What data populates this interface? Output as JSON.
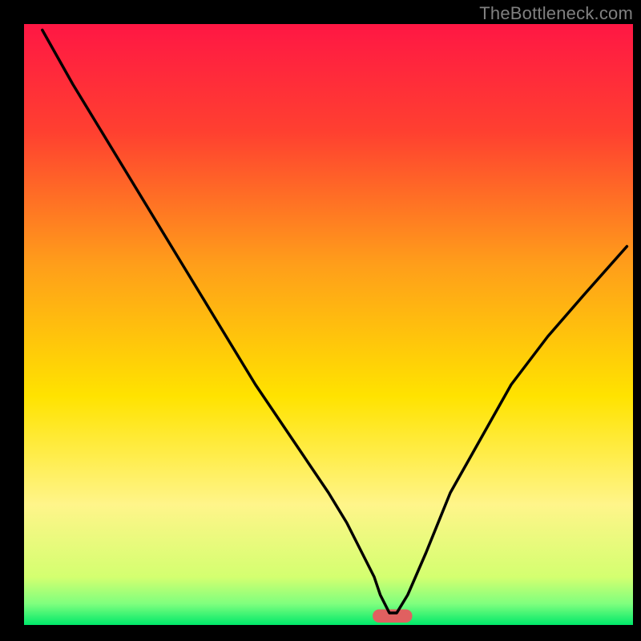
{
  "watermark": "TheBottleneck.com",
  "chart_data": {
    "type": "line",
    "title": "",
    "xlabel": "",
    "ylabel": "",
    "xlim": [
      0,
      100
    ],
    "ylim": [
      0,
      100
    ],
    "grid": false,
    "legend": false,
    "background_gradient_stops": [
      {
        "offset": 0.0,
        "color": "#ff1744"
      },
      {
        "offset": 0.18,
        "color": "#ff4030"
      },
      {
        "offset": 0.4,
        "color": "#ff9e1a"
      },
      {
        "offset": 0.62,
        "color": "#ffe300"
      },
      {
        "offset": 0.8,
        "color": "#fff58a"
      },
      {
        "offset": 0.92,
        "color": "#d4ff70"
      },
      {
        "offset": 0.965,
        "color": "#7eff7e"
      },
      {
        "offset": 1.0,
        "color": "#00e86a"
      }
    ],
    "curve": {
      "x": [
        3,
        8,
        14,
        20,
        26,
        32,
        38,
        44,
        50,
        53,
        55,
        56.5,
        57.5,
        58.5,
        60,
        61.2,
        63,
        66,
        70,
        75,
        80,
        86,
        92,
        99
      ],
      "y": [
        99,
        90,
        80,
        70,
        60,
        50,
        40,
        31,
        22,
        17,
        13,
        10,
        8,
        5,
        2.0,
        2.0,
        5,
        12,
        22,
        31,
        40,
        48,
        55,
        63
      ]
    },
    "marker": {
      "x": 60.5,
      "y": 1.5,
      "width": 6.5,
      "height": 2.2,
      "color": "#e06060"
    }
  }
}
